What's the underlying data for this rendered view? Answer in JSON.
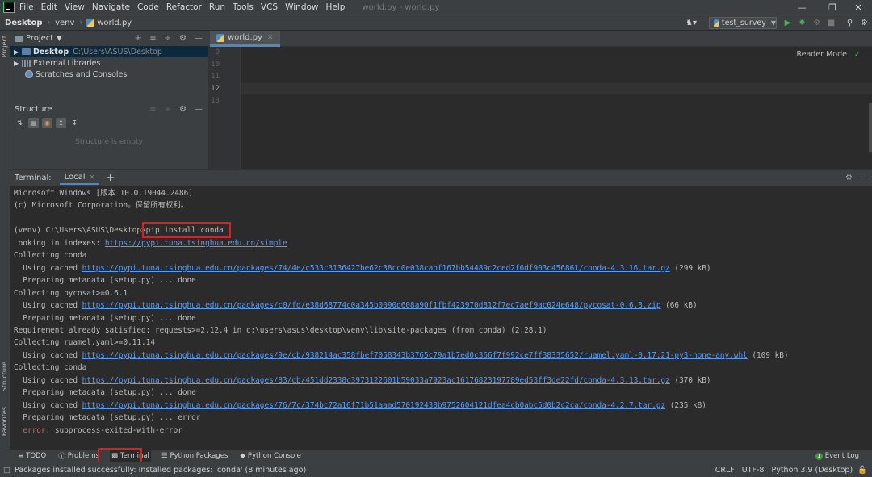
{
  "menubar": {
    "items": [
      "File",
      "Edit",
      "View",
      "Navigate",
      "Code",
      "Refactor",
      "Run",
      "Tools",
      "VCS",
      "Window",
      "Help"
    ],
    "window_title": "world.py - world.py"
  },
  "navbar": {
    "crumbs": [
      "Desktop",
      "venv",
      "world.py"
    ],
    "run_config": "test_survey"
  },
  "left_stripe": {
    "project": "Project",
    "structure": "Structure",
    "favorites": "Favorites"
  },
  "project_panel": {
    "title": "Project",
    "root_name": "Desktop",
    "root_path": "C:\\Users\\ASUS\\Desktop",
    "libs": "External Libraries",
    "scratches": "Scratches and Consoles"
  },
  "structure_panel": {
    "title": "Structure",
    "empty": "Structure is empty"
  },
  "editor": {
    "tab": "world.py",
    "line_numbers": [
      "9",
      "10",
      "11",
      "12",
      "13"
    ],
    "reader_mode": "Reader Mode"
  },
  "terminal": {
    "label": "Terminal:",
    "tab": "Local",
    "lines": [
      {
        "text": "Microsoft Windows [版本 10.0.19044.2486]"
      },
      {
        "text": "(c) Microsoft Corporation。保留所有权利。"
      },
      {
        "text": ""
      },
      {
        "text": "(venv) C:\\Users\\ASUS\\Desktop>pip install conda"
      },
      {
        "text": "Looking in indexes: ",
        "link": "https://pypi.tuna.tsinghua.edu.cn/simple",
        "after": ""
      },
      {
        "text": "Collecting conda"
      },
      {
        "text": "  Using cached ",
        "link": "https://pypi.tuna.tsinghua.edu.cn/packages/74/4e/c533c3136427be62c38cc0e038cabf167bb54489c2ced2f6df903c456861/conda-4.3.16.tar.gz",
        "after": " (299 kB)"
      },
      {
        "text": "  Preparing metadata (setup.py) ... done"
      },
      {
        "text": "Collecting pycosat>=0.6.1"
      },
      {
        "text": "  Using cached ",
        "link": "https://pypi.tuna.tsinghua.edu.cn/packages/c0/fd/e38d68774c0a345b0090d608a90f1fbf423970d812f7ec7aef9ac024e648/pycosat-0.6.3.zip",
        "after": " (66 kB)"
      },
      {
        "text": "  Preparing metadata (setup.py) ... done"
      },
      {
        "text": "Requirement already satisfied: requests>=2.12.4 in c:\\users\\asus\\desktop\\venv\\lib\\site-packages (from conda) (2.28.1)"
      },
      {
        "text": "Collecting ruamel.yaml>=0.11.14"
      },
      {
        "text": "  Using cached ",
        "link": "https://pypi.tuna.tsinghua.edu.cn/packages/9e/cb/938214ac358fbef7058343b3765c79a1b7ed0c366f7f992ce7ff38335652/ruamel.yaml-0.17.21-py3-none-any.whl",
        "after": " (109 kB)"
      },
      {
        "text": "Collecting conda"
      },
      {
        "text": "  Using cached ",
        "link": "https://pypi.tuna.tsinghua.edu.cn/packages/83/cb/451dd2338c3973122601b59033a7923ac16176823197789ed53ff3de22fd/conda-4.3.13.tar.gz",
        "after": " (370 kB)"
      },
      {
        "text": "  Preparing metadata (setup.py) ... done"
      },
      {
        "text": "  Using cached ",
        "link": "https://pypi.tuna.tsinghua.edu.cn/packages/76/7c/374bc72a16f71b51aaad570192438b9752604121dfea4cb0abc5d0b2c2ca/conda-4.2.7.tar.gz",
        "after": " (235 kB)"
      },
      {
        "text": "  Preparing metadata (setup.py) ... error"
      },
      {
        "text": "  ",
        "err": "error",
        "after": ": subprocess-exited-with-error"
      }
    ]
  },
  "tool_windows": {
    "todo": "TODO",
    "problems": "Problems",
    "terminal": "Terminal",
    "python_packages": "Python Packages",
    "python_console": "Python Console",
    "event_log": "Event Log",
    "event_count": "1"
  },
  "statusbar": {
    "message": "Packages installed successfully: Installed packages: 'conda' (8 minutes ago)",
    "line_sep": "CRLF",
    "encoding": "UTF-8",
    "interpreter": "Python 3.9 (Desktop)"
  },
  "colors": {
    "highlight_box": "#e11d1d",
    "link": "#589df6",
    "error": "#cc6666",
    "run_green": "#4caf50"
  }
}
